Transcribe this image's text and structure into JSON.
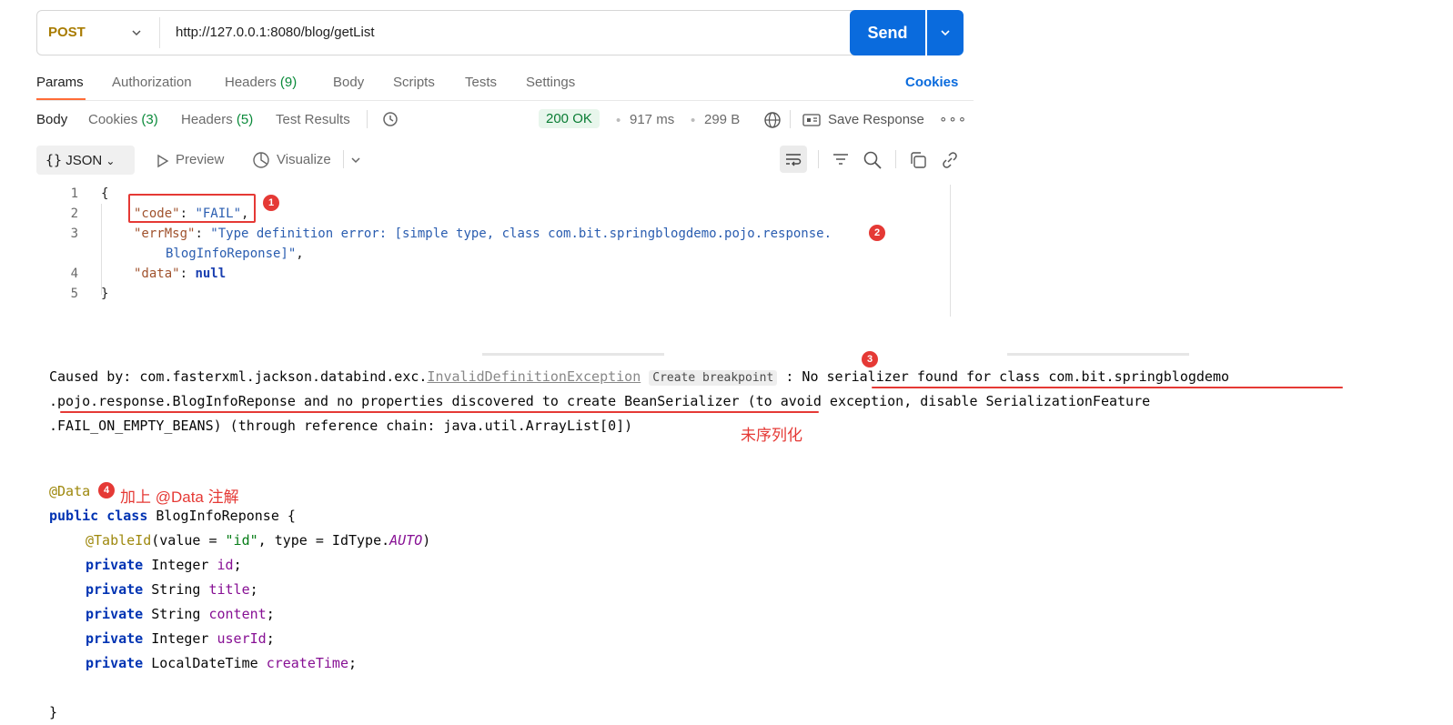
{
  "request": {
    "method": "POST",
    "url": "http://127.0.0.1:8080/blog/getList",
    "send_label": "Send"
  },
  "request_tabs": {
    "params": "Params",
    "authorization": "Authorization",
    "headers": "Headers",
    "headers_count": "(9)",
    "body": "Body",
    "scripts": "Scripts",
    "tests": "Tests",
    "settings": "Settings",
    "cookies": "Cookies"
  },
  "response_tabs": {
    "body": "Body",
    "cookies": "Cookies",
    "cookies_count": "(3)",
    "headers": "Headers",
    "headers_count": "(5)",
    "test_results": "Test Results"
  },
  "response_meta": {
    "status": "200 OK",
    "time": "917 ms",
    "size": "299 B",
    "save_response": "Save Response"
  },
  "toolbar": {
    "format": "JSON",
    "preview": "Preview",
    "visualize": "Visualize"
  },
  "json_lines": {
    "l1": "{",
    "key_code": "\"code\"",
    "val_code": "\"FAIL\"",
    "key_errmsg": "\"errMsg\"",
    "val_errmsg_1": "\"Type definition error: [simple type, class com.bit.springblogdemo.pojo.response.",
    "val_errmsg_2": "BlogInfoReponse]\"",
    "key_data": "\"data\"",
    "val_data": "null",
    "l5": "}"
  },
  "line_numbers": [
    "1",
    "2",
    "3",
    "4",
    "5"
  ],
  "badges": [
    "1",
    "2",
    "3",
    "4"
  ],
  "exception": {
    "prefix": "Caused by: com.fasterxml.jackson.databind.exc.",
    "class_name": "InvalidDefinitionException",
    "breakpoint": "Create breakpoint",
    "sep": " : ",
    "msg1": "No serializer found for class com.bit.springblogdemo",
    "msg2": ".pojo.response.BlogInfoReponse and no properties discovered to create BeanSerializer",
    "msg2_rest": " (to avoid exception, disable SerializationFeature",
    "msg3": ".FAIL_ON_EMPTY_BEANS) (through reference chain: java.util.ArrayList[0])",
    "annotation": "未序列化"
  },
  "code": {
    "ann_data": "@Data",
    "annotation_note": "加上 @Data 注解",
    "class_decl_kw": "public class ",
    "class_name": "BlogInfoReponse",
    "class_open": " {",
    "table_id": "@TableId",
    "table_id_args_1": "(value = ",
    "table_id_str": "\"id\"",
    "table_id_args_2": ", type = IdType.",
    "table_id_auto": "AUTO",
    "table_id_close": ")",
    "fields": [
      {
        "kw": "private ",
        "type": "Integer ",
        "name": "id"
      },
      {
        "kw": "private ",
        "type": "String ",
        "name": "title"
      },
      {
        "kw": "private ",
        "type": "String ",
        "name": "content"
      },
      {
        "kw": "private ",
        "type": "Integer ",
        "name": "userId"
      },
      {
        "kw": "private ",
        "type": "LocalDateTime ",
        "name": "createTime"
      }
    ],
    "class_close": "}"
  },
  "colors": {
    "accent": "#0a6bdd",
    "status_ok": "#0a7d34",
    "annotation_red": "#e53935",
    "tab_active": "#ff6c37"
  }
}
